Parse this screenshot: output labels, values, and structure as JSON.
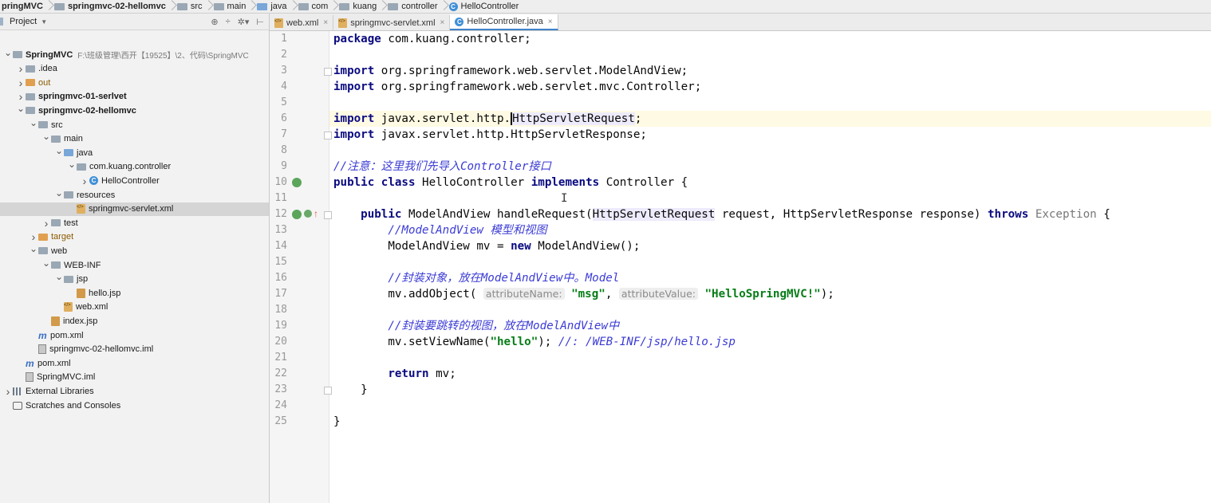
{
  "breadcrumb": [
    "pringMVC",
    "springmvc-02-hellomvc",
    "src",
    "main",
    "java",
    "com",
    "kuang",
    "controller",
    "HelloController"
  ],
  "project_pane": {
    "title": "Project",
    "root_path": "F:\\班级管理\\西开【19525】\\2、代码\\SpringMVC"
  },
  "tree": [
    {
      "label": "SpringMVC",
      "indent": 0,
      "arrow": "v",
      "icon": "folder",
      "bold": true
    },
    {
      "label": ".idea",
      "indent": 1,
      "arrow": ">",
      "icon": "folder"
    },
    {
      "label": "out",
      "indent": 1,
      "arrow": ">",
      "icon": "folder-orange",
      "orange": true
    },
    {
      "label": "springmvc-01-serlvet",
      "indent": 1,
      "arrow": ">",
      "icon": "folder",
      "bold": true
    },
    {
      "label": "springmvc-02-hellomvc",
      "indent": 1,
      "arrow": "v",
      "icon": "folder",
      "bold": true
    },
    {
      "label": "src",
      "indent": 2,
      "arrow": "v",
      "icon": "folder"
    },
    {
      "label": "main",
      "indent": 3,
      "arrow": "v",
      "icon": "folder"
    },
    {
      "label": "java",
      "indent": 4,
      "arrow": "v",
      "icon": "folder-blue"
    },
    {
      "label": "com.kuang.controller",
      "indent": 5,
      "arrow": "v",
      "icon": "folder"
    },
    {
      "label": "HelloController",
      "indent": 6,
      "arrow": ">",
      "icon": "class"
    },
    {
      "label": "resources",
      "indent": 4,
      "arrow": "v",
      "icon": "folder-res"
    },
    {
      "label": "springmvc-servlet.xml",
      "indent": 5,
      "arrow": "",
      "icon": "xml",
      "selected": true
    },
    {
      "label": "test",
      "indent": 3,
      "arrow": ">",
      "icon": "folder"
    },
    {
      "label": "target",
      "indent": 2,
      "arrow": ">",
      "icon": "folder-orange",
      "orange": true
    },
    {
      "label": "web",
      "indent": 2,
      "arrow": "v",
      "icon": "folder"
    },
    {
      "label": "WEB-INF",
      "indent": 3,
      "arrow": "v",
      "icon": "folder"
    },
    {
      "label": "jsp",
      "indent": 4,
      "arrow": "v",
      "icon": "folder"
    },
    {
      "label": "hello.jsp",
      "indent": 5,
      "arrow": "",
      "icon": "jsp"
    },
    {
      "label": "web.xml",
      "indent": 4,
      "arrow": "",
      "icon": "xml"
    },
    {
      "label": "index.jsp",
      "indent": 3,
      "arrow": "",
      "icon": "jsp"
    },
    {
      "label": "pom.xml",
      "indent": 2,
      "arrow": "",
      "icon": "maven"
    },
    {
      "label": "springmvc-02-hellomvc.iml",
      "indent": 2,
      "arrow": "",
      "icon": "iml"
    },
    {
      "label": "pom.xml",
      "indent": 1,
      "arrow": "",
      "icon": "maven"
    },
    {
      "label": "SpringMVC.iml",
      "indent": 1,
      "arrow": "",
      "icon": "iml"
    },
    {
      "label": "External Libraries",
      "indent": 0,
      "arrow": ">",
      "icon": "lib"
    },
    {
      "label": "Scratches and Consoles",
      "indent": 0,
      "arrow": "",
      "icon": "scratch"
    }
  ],
  "tabs": [
    {
      "label": "web.xml",
      "icon": "xml"
    },
    {
      "label": "springmvc-servlet.xml",
      "icon": "xml"
    },
    {
      "label": "HelloController.java",
      "icon": "class",
      "active": true
    }
  ],
  "code_lines": [
    "package com.kuang.controller;",
    "",
    "import org.springframework.web.servlet.ModelAndView;",
    "import org.springframework.web.servlet.mvc.Controller;",
    "",
    "import javax.servlet.http.HttpServletRequest;",
    "import javax.servlet.http.HttpServletResponse;",
    "",
    "//注意：这里我们先导入Controller接口",
    "public class HelloController implements Controller {",
    "",
    "    public ModelAndView handleRequest(HttpServletRequest request, HttpServletResponse response) throws Exception {",
    "        //ModelAndView 模型和视图",
    "        ModelAndView mv = new ModelAndView();",
    "",
    "        //封装对象，放在ModelAndView中。Model",
    "        mv.addObject( attributeName: \"msg\", attributeValue: \"HelloSpringMVC!\");",
    "",
    "        //封装要跳转的视图，放在ModelAndView中",
    "        mv.setViewName(\"hello\"); //: /WEB-INF/jsp/hello.jsp",
    "",
    "        return mv;",
    "    }",
    "",
    "}"
  ]
}
